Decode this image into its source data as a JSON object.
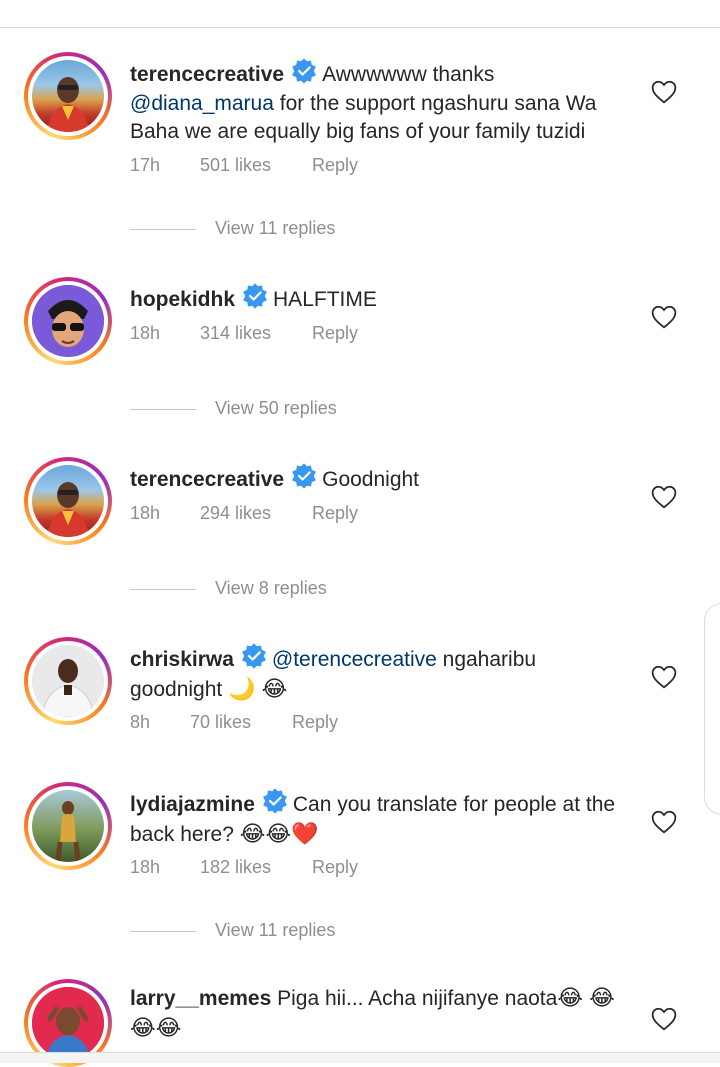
{
  "colors": {
    "mention": "#00376b",
    "verified": "#3897f0",
    "meta": "#8e8e8e"
  },
  "comments": [
    {
      "username": "terencecreative",
      "text_before": "Awwwwww thanks ",
      "mention": "@diana_marua",
      "text_after": " for the support ngashuru sana Wa Baha we are equally big fans of your family tuzidi",
      "time": "17h",
      "likes": "501 likes",
      "reply": "Reply",
      "view_replies": "View 11 replies"
    },
    {
      "username": "hopekidhk",
      "text": "HALFTIME",
      "time": "18h",
      "likes": "314 likes",
      "reply": "Reply",
      "view_replies": "View 50 replies"
    },
    {
      "username": "terencecreative",
      "text": "Goodnight",
      "time": "18h",
      "likes": "294 likes",
      "reply": "Reply",
      "view_replies": "View 8 replies"
    },
    {
      "username": "chriskirwa",
      "mention": "@terencecreative",
      "text_after": " ngaharibu goodnight ",
      "emoji": "🌙 😂",
      "time": "8h",
      "likes": "70 likes",
      "reply": "Reply"
    },
    {
      "username": "lydiajazmine",
      "text": "Can you translate for people at the back here? ",
      "emoji": "😂😂❤️",
      "time": "18h",
      "likes": "182 likes",
      "reply": "Reply",
      "view_replies": "View 11 replies"
    },
    {
      "username": "larry__memes",
      "text": "Piga hii... Acha nijifanye naota",
      "emoji": "😂 😂😂😂"
    }
  ],
  "icons": {
    "verified": "verified-badge-icon",
    "like": "heart-outline-icon"
  }
}
